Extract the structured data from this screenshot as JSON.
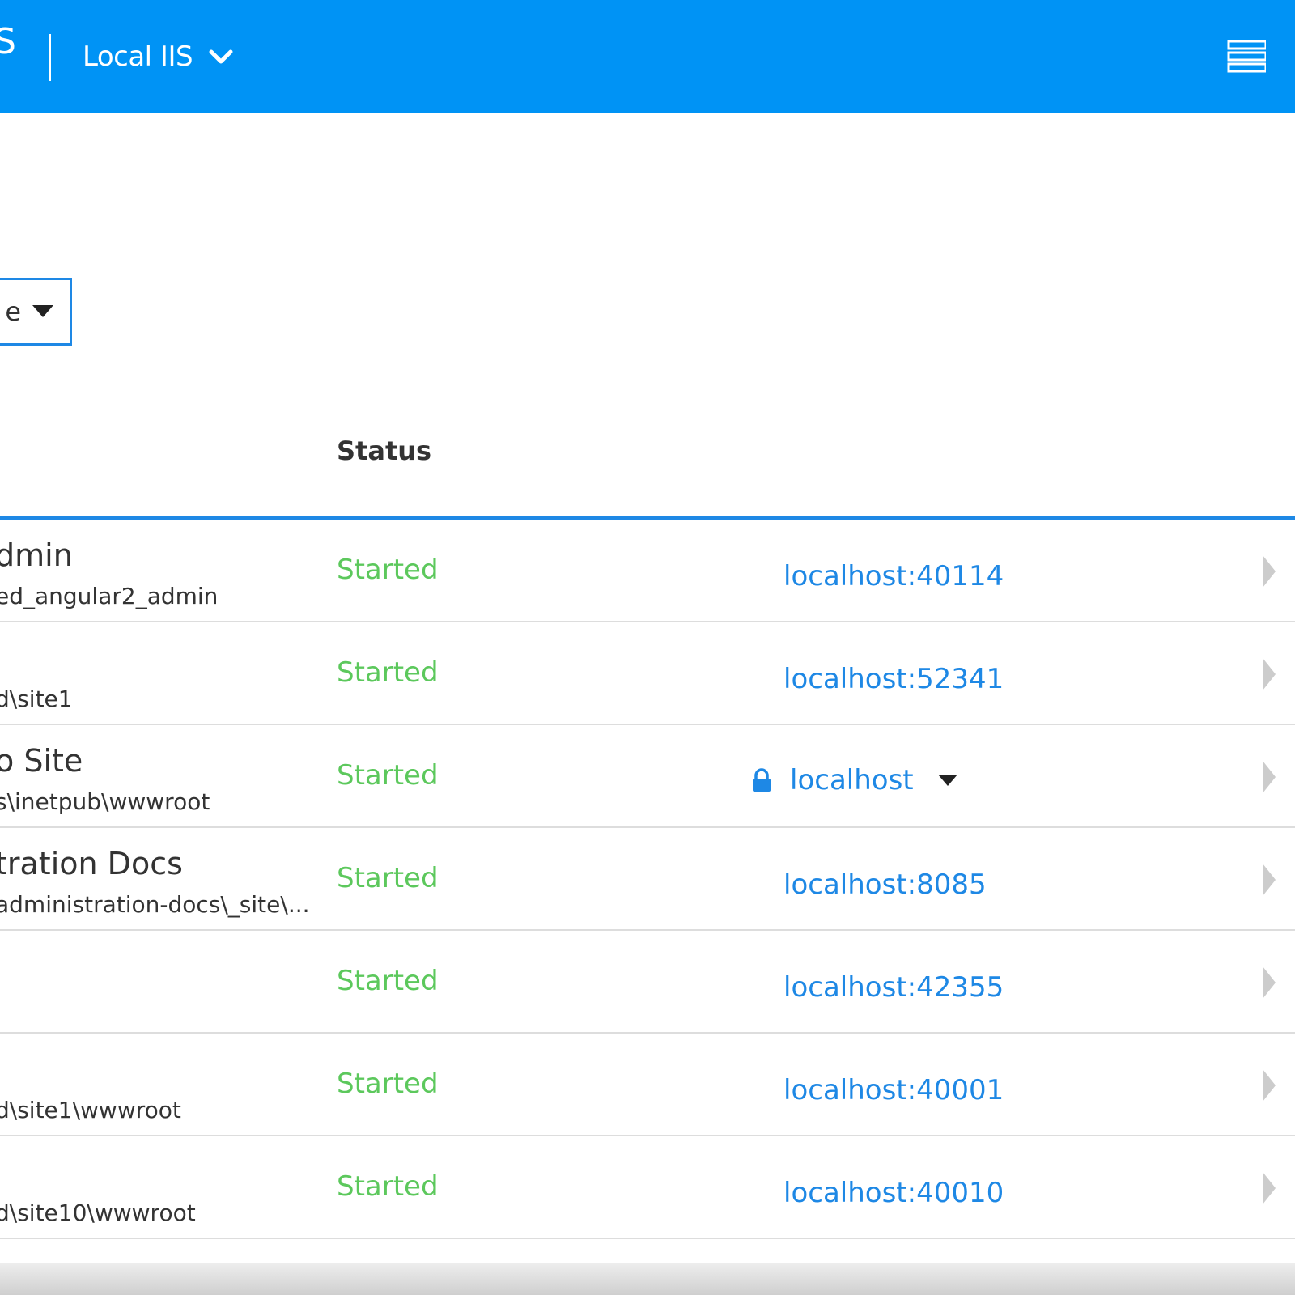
{
  "header": {
    "brand_fragment": "S",
    "server_label": "Local IIS",
    "chevron_icon": "chevron-down-icon",
    "menu_icon": "server-list-icon",
    "background_color": "#0093f5"
  },
  "filter": {
    "value_fragment": "e",
    "caret_icon": "caret-down-icon"
  },
  "table": {
    "status_header": "Status",
    "rows": [
      {
        "name": "dmin",
        "path": "ed_angular2_admin",
        "status": "Started",
        "binding": "localhost:40114"
      },
      {
        "name": "",
        "path": "d\\site1",
        "status": "Started",
        "binding": "localhost:52341"
      },
      {
        "name": "o Site",
        "path": "s\\inetpub\\wwwroot",
        "status": "Started",
        "binding": "localhost",
        "secure": true,
        "multiple_bindings": true
      },
      {
        "name": "tration Docs",
        "path": "administration-docs\\_site\\...",
        "status": "Started",
        "binding": "localhost:8085"
      },
      {
        "name": "",
        "path": "",
        "status": "Started",
        "binding": "localhost:42355"
      },
      {
        "name": "",
        "path": "d\\site1\\wwwroot",
        "status": "Started",
        "binding": "localhost:40001"
      },
      {
        "name": "",
        "path": "d\\site10\\wwwroot",
        "status": "Started",
        "binding": "localhost:40010"
      }
    ]
  },
  "colors": {
    "status_started": "#5cc85c",
    "link": "#1e88e5",
    "divider": "#dddddd"
  }
}
